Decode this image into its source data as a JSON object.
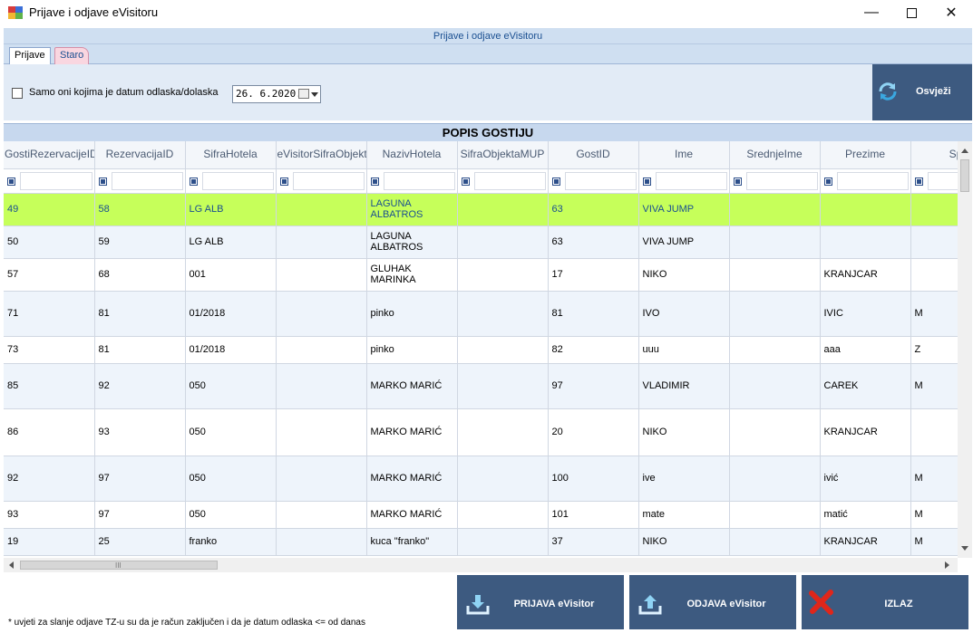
{
  "window": {
    "title": "Prijave i odjave eVisitoru"
  },
  "header": {
    "title": "Prijave i odjave eVisitoru"
  },
  "tabs": [
    {
      "label": "Prijave"
    },
    {
      "label": "Staro"
    }
  ],
  "filter": {
    "checkbox_label": "Samo oni kojima je datum odlaska/dolaska",
    "date_value": "26.  6.2020."
  },
  "refresh": {
    "label": "Osvježi"
  },
  "grid": {
    "caption": "POPIS GOSTIJU",
    "columns": [
      "GostiRezervacijeID",
      "RezervacijaID",
      "SifraHotela",
      "eVisitorSifraObjekta",
      "NazivHotela",
      "SifraObjektaMUP",
      "GostID",
      "Ime",
      "SrednjeIme",
      "Prezime",
      "Sp"
    ],
    "rows": [
      [
        "49",
        "58",
        "LG ALB",
        "",
        "LAGUNA ALBATROS",
        "",
        "63",
        "VIVA JUMP",
        "",
        "",
        ""
      ],
      [
        "50",
        "59",
        "LG ALB",
        "",
        "LAGUNA ALBATROS",
        "",
        "63",
        "VIVA JUMP",
        "",
        "",
        ""
      ],
      [
        "57",
        "68",
        "001",
        "",
        "GLUHAK MARINKA",
        "",
        "17",
        "NIKO",
        "",
        "KRANJCAR",
        ""
      ],
      [
        "71",
        "81",
        "01/2018",
        "",
        "pinko",
        "",
        "81",
        "IVO",
        "",
        "IVIC",
        "M"
      ],
      [
        "73",
        "81",
        "01/2018",
        "",
        "pinko",
        "",
        "82",
        "uuu",
        "",
        "aaa",
        "Z"
      ],
      [
        "85",
        "92",
        "050",
        "",
        "MARKO MARIĆ",
        "",
        "97",
        "VLADIMIR",
        "",
        "CAREK",
        "M"
      ],
      [
        "86",
        "93",
        "050",
        "",
        "MARKO MARIĆ",
        "",
        "20",
        "NIKO",
        "",
        "KRANJCAR",
        ""
      ],
      [
        "92",
        "97",
        "050",
        "",
        "MARKO MARIĆ",
        "",
        "100",
        "ive",
        "",
        "ivić",
        "M"
      ],
      [
        "93",
        "97",
        "050",
        "",
        "MARKO MARIĆ",
        "",
        "101",
        "mate",
        "",
        "matić",
        "M"
      ],
      [
        "19",
        "25",
        "franko",
        "",
        "kuca \"franko\"",
        "",
        "37",
        "NIKO",
        "",
        "KRANJCAR",
        "M"
      ]
    ]
  },
  "scroll": {
    "grip": "III"
  },
  "actions": {
    "prijava": "PRIJAVA eVisitor",
    "odjava": "ODJAVA eVisitor",
    "izlaz": "IZLAZ"
  },
  "note": "* uvjeti za slanje odjave TZ-u su da je račun zaključen i da je datum odlaska <= od danas",
  "colors": {
    "selected_row": "#c6ff5a",
    "button": "#3d5a80",
    "header_strip": "#cfdff1"
  },
  "icons": [
    "app-icon",
    "refresh-icon",
    "upload-icon",
    "close-x-icon",
    "filter-icon",
    "calendar-icon"
  ]
}
